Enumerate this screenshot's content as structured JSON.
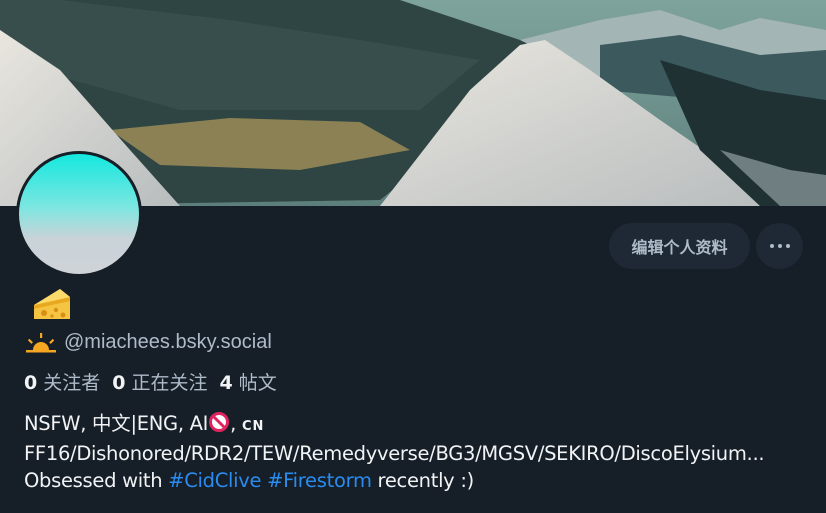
{
  "profile": {
    "display_name_icon": "cheese-emoji",
    "handle_icon": "sunrise-icon",
    "handle": "@miachees.bsky.social",
    "edit_label": "编辑个人资料",
    "more_icon": "ellipsis-icon"
  },
  "stats": {
    "followers_count": "0",
    "followers_label": "关注者",
    "following_count": "0",
    "following_label": "正在关注",
    "posts_count": "4",
    "posts_label": "帖文"
  },
  "bio": {
    "line1_prefix": "NSFW, 中文|ENG, AI",
    "line1_icon": "prohibited-icon",
    "line1_suffix_sep": ", ",
    "line1_suffix": "CN",
    "line2": "FF16/Dishonored/RDR2/TEW/Remedyverse/BG3/MGSV/SEKIRO/DiscoElysium...",
    "line3_prefix": "Obsessed with ",
    "tag1": "#CidClive",
    "tag2": "#Firestorm",
    "line3_suffix": " recently :)"
  },
  "colors": {
    "background": "#161e27",
    "button_bg": "#1e2935",
    "muted_text": "#aebbc9",
    "link": "#2a8cf0"
  }
}
